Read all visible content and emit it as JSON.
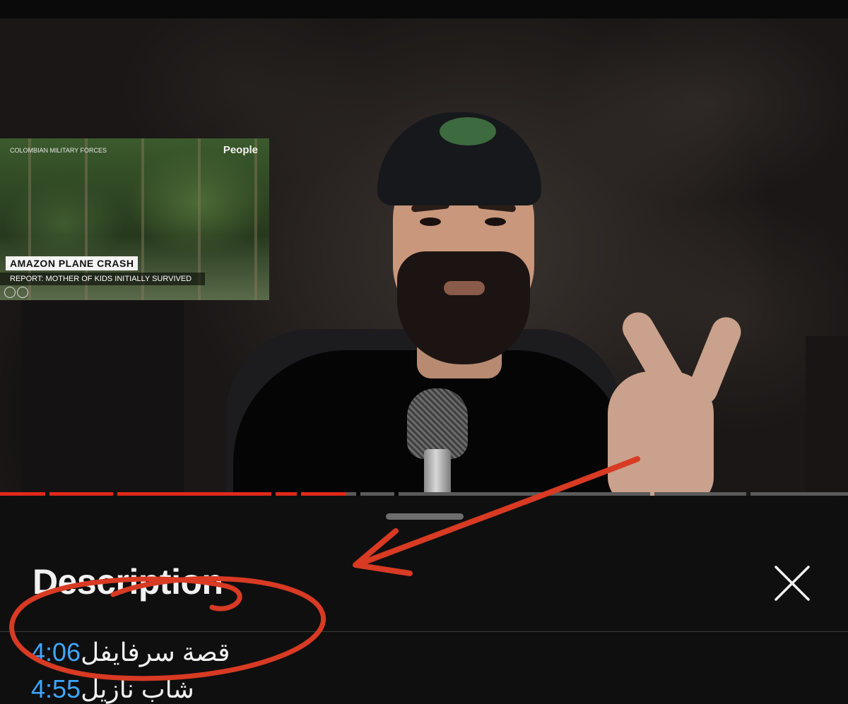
{
  "video": {
    "inset": {
      "source_label": "COLOMBIAN MILITARY FORCES",
      "brand_logo": "People",
      "headline": "AMAZON PLANE CRASH",
      "subheadline": "REPORT: MOTHER OF KIDS INITIALLY SURVIVED"
    },
    "progress": {
      "played_fraction": 0.41
    }
  },
  "description_sheet": {
    "title": "Description",
    "close_icon": "close-icon",
    "chapters": [
      {
        "text": "قصة سرفايفل",
        "time": "4:06"
      },
      {
        "text": "شاب نازيل",
        "time": "4:55"
      }
    ]
  },
  "colors": {
    "progress_played": "#e0291c",
    "timestamp_link": "#3ea6ff",
    "annotation": "#d83a23",
    "sheet_bg": "#0f0f0f"
  }
}
